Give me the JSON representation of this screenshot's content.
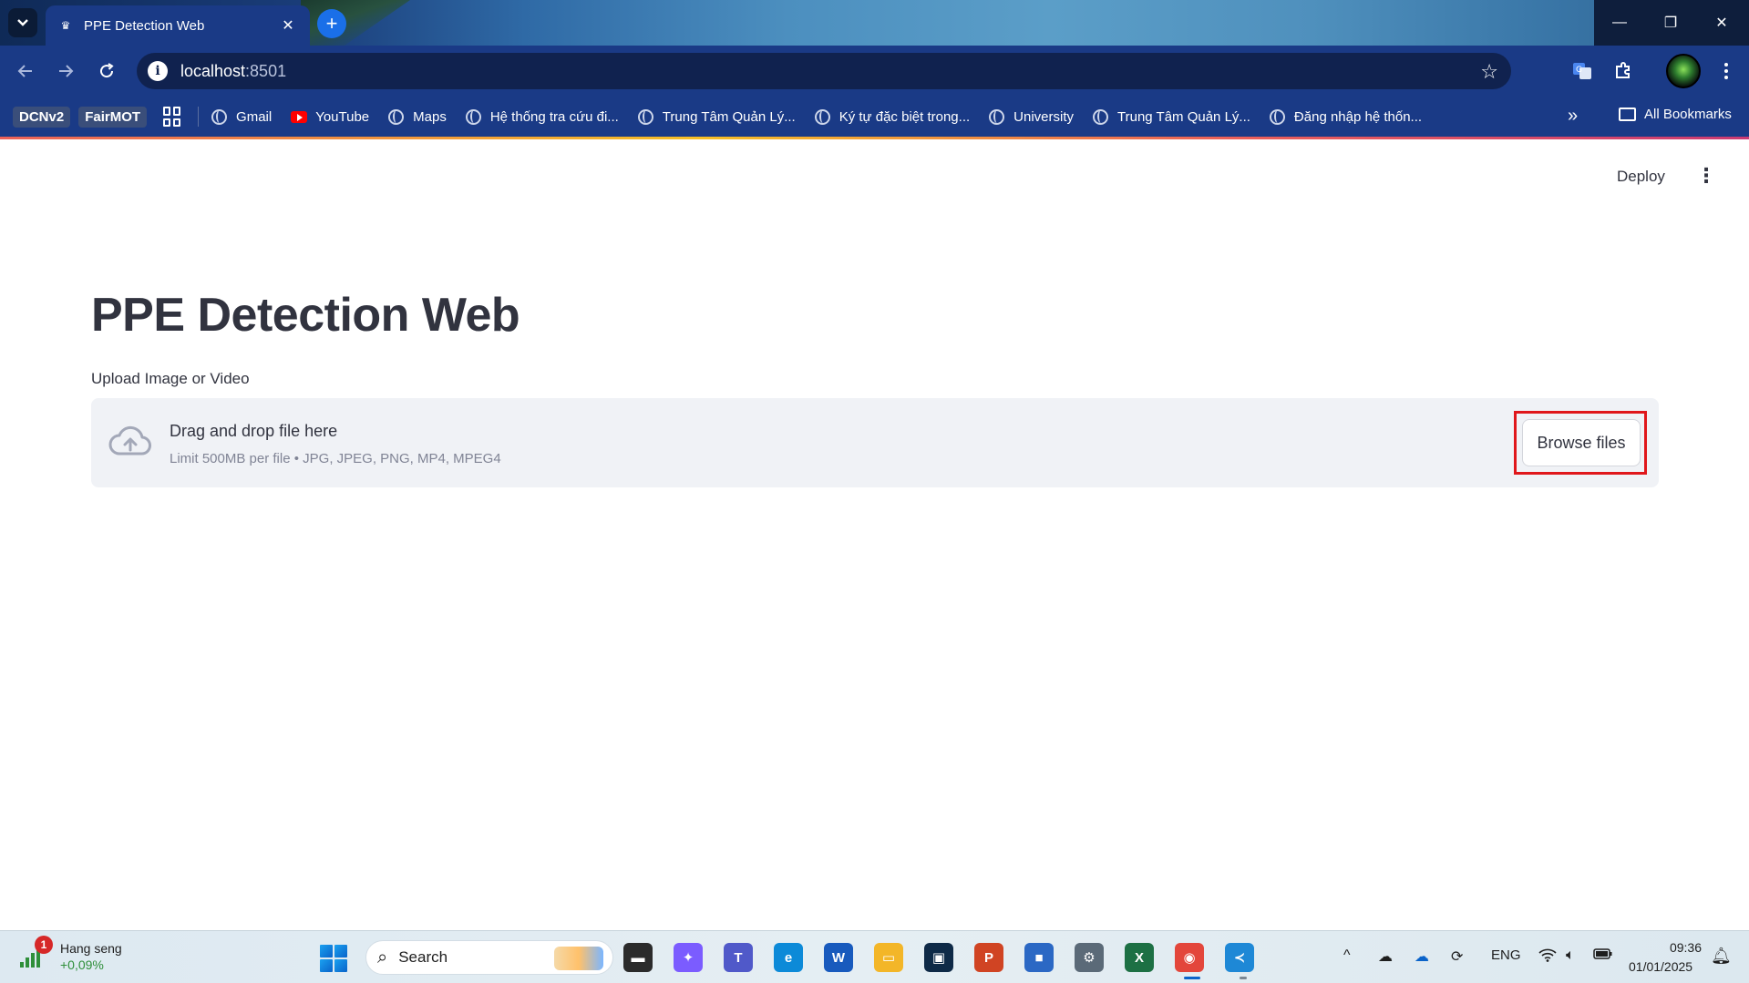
{
  "browser": {
    "tab": {
      "title": "PPE Detection Web",
      "favicon": "crown-icon",
      "close": "✕"
    },
    "new_tab_label": "+",
    "window_controls": {
      "minimize": "—",
      "restore": "❐",
      "close": "✕"
    },
    "address": {
      "host": "localhost",
      "port": ":8501"
    },
    "nav": {
      "back": "←",
      "forward": "→",
      "reload": "⟳"
    },
    "bookmarks": {
      "pills": [
        "DCNv2",
        "FairMOT"
      ],
      "items": [
        {
          "label": "Gmail",
          "icon": "globe-icon"
        },
        {
          "label": "YouTube",
          "icon": "youtube-icon"
        },
        {
          "label": "Maps",
          "icon": "globe-icon"
        },
        {
          "label": "Hệ thống tra cứu đi...",
          "icon": "globe-icon"
        },
        {
          "label": "Trung Tâm Quản Lý...",
          "icon": "globe-icon"
        },
        {
          "label": "Ký tự đặc biệt trong...",
          "icon": "globe-icon"
        },
        {
          "label": "University",
          "icon": "globe-icon"
        },
        {
          "label": "Trung Tâm Quản Lý...",
          "icon": "globe-icon"
        },
        {
          "label": "Đăng nhập hệ thốn...",
          "icon": "globe-icon"
        }
      ],
      "overflow": "»",
      "all_bookmarks": "All Bookmarks"
    }
  },
  "app": {
    "deploy_label": "Deploy",
    "menu_icon": "⋮",
    "title": "PPE Detection Web",
    "uploader": {
      "label": "Upload Image or Video",
      "drop_text": "Drag and drop file here",
      "limit_text": "Limit 500MB per file • JPG, JPEG, PNG, MP4, MPEG4",
      "browse_label": "Browse files",
      "highlight_color": "#e0171b"
    }
  },
  "taskbar": {
    "widget": {
      "badge": "1",
      "name": "Hang seng",
      "change": "+0,09%"
    },
    "search_label": "Search",
    "apps": [
      {
        "name": "file-explorer-dark",
        "glyph": "▬",
        "bg": "#2b2b2b"
      },
      {
        "name": "copilot",
        "glyph": "✦",
        "bg": "#7b5cff"
      },
      {
        "name": "teams",
        "glyph": "T",
        "bg": "#5059c9"
      },
      {
        "name": "edge",
        "glyph": "e",
        "bg": "#0c8ad8"
      },
      {
        "name": "word",
        "glyph": "W",
        "bg": "#185abd"
      },
      {
        "name": "file-explorer",
        "glyph": "▭",
        "bg": "#f3b628"
      },
      {
        "name": "terminal-app",
        "glyph": "▣",
        "bg": "#0e2a47"
      },
      {
        "name": "powerpoint",
        "glyph": "P",
        "bg": "#d04423"
      },
      {
        "name": "store",
        "glyph": "■",
        "bg": "#2b68c4"
      },
      {
        "name": "settings",
        "glyph": "⚙",
        "bg": "#5b6a78"
      },
      {
        "name": "excel",
        "glyph": "X",
        "bg": "#1d7044"
      },
      {
        "name": "chrome",
        "glyph": "◉",
        "bg": "#e3463b"
      },
      {
        "name": "vscode",
        "glyph": "≺",
        "bg": "#1e88d6"
      }
    ],
    "tray": {
      "chevron": "^",
      "lang": "ENG",
      "wifi": "wifi-icon",
      "volume": "volume-icon",
      "battery": "battery-icon"
    },
    "clock": {
      "time": "09:36",
      "date": "01/01/2025"
    }
  }
}
